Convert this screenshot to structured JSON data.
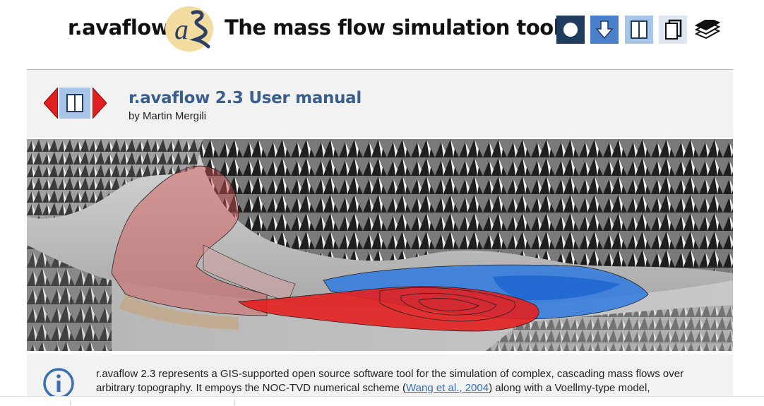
{
  "header": {
    "app_name": "r.avaflow",
    "tagline": "The mass flow simulation tool",
    "logo_text": "a",
    "buttons": [
      {
        "name": "record",
        "icon": "circle-icon"
      },
      {
        "name": "download",
        "icon": "download-arrow-icon"
      },
      {
        "name": "layout",
        "icon": "columns-icon"
      },
      {
        "name": "page",
        "icon": "page-icon"
      },
      {
        "name": "layers",
        "icon": "layers-icon"
      }
    ]
  },
  "manual": {
    "title": "r.avaflow 2.3 User manual",
    "author": "by Martin Mergili"
  },
  "hero": {
    "description_icon": "terrain-simulation-image"
  },
  "info": {
    "text_before_link": "r.avaflow 2.3 represents a GIS-supported open source software tool for the simulation of complex, cascading mass flows over arbitrary topography. It empoys the NOC-TVD numerical scheme (",
    "link_text": "Wang et al., 2004",
    "text_after_link": ") along with a Voellmy-type model,"
  },
  "colors": {
    "accent_dark": "#1f3b5e",
    "accent_mid": "#4a7fcc",
    "accent_light": "#a8c4e6",
    "title_blue": "#3a5f8e",
    "nav_red": "#e02020"
  }
}
